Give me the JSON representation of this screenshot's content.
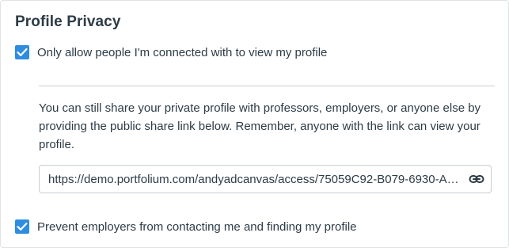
{
  "section": {
    "title": "Profile Privacy"
  },
  "options": {
    "connected_only": {
      "label": "Only allow people I'm connected with to view my profile",
      "checked": true
    },
    "prevent_employers": {
      "label": "Prevent employers from contacting me and finding my profile",
      "checked": true
    }
  },
  "share": {
    "description": "You can still share your private profile with professors, employers, or anyone else by providing the public share link below. Remember, anyone with the link can view your profile.",
    "link": "https://demo.portfolium.com/andyadcanvas/access/75059C92-B079-6930-A5...",
    "link_icon": "link-icon"
  },
  "colors": {
    "checkbox": "#2f8ddf",
    "text": "#2d3b45",
    "border": "#c7cdd1"
  }
}
